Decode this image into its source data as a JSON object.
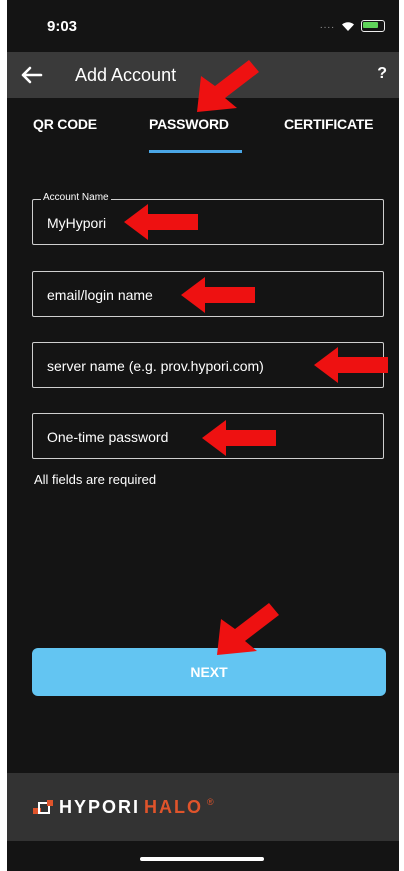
{
  "status_bar": {
    "time": "9:03",
    "signal_dots": "...."
  },
  "app_bar": {
    "title": "Add Account",
    "help": "?"
  },
  "tabs": [
    {
      "label": "QR CODE",
      "selected": false
    },
    {
      "label": "PASSWORD",
      "selected": true
    },
    {
      "label": "CERTIFICATE",
      "selected": false
    }
  ],
  "form": {
    "account_name": {
      "label": "Account Name",
      "value": "MyHypori"
    },
    "login": {
      "placeholder": "email/login name"
    },
    "server": {
      "placeholder": "server name (e.g. prov.hypori.com)"
    },
    "otp": {
      "placeholder": "One-time password"
    },
    "helper": "All fields are required"
  },
  "next_label": "NEXT",
  "footer": {
    "brand_main": "HYPORI",
    "brand_accent": "HALO",
    "trademark": "®"
  },
  "colors": {
    "accent_blue": "#4aa6e6",
    "button": "#63c5f2",
    "annotation_red": "#ee1111",
    "brand_orange": "#e0542b"
  }
}
